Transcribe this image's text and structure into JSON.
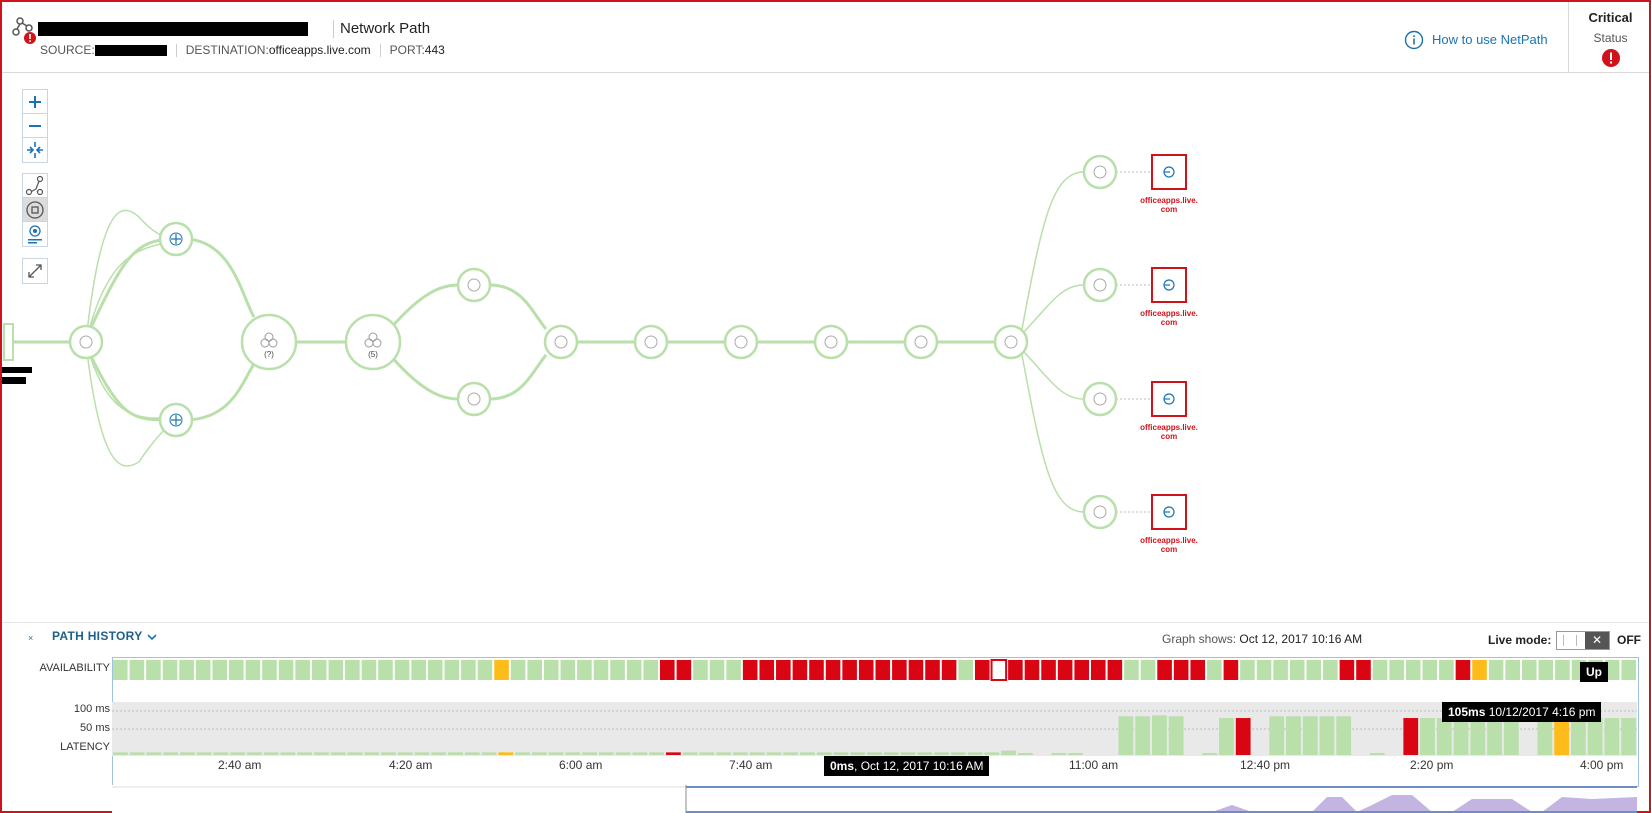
{
  "header": {
    "title": "Network Path",
    "source_label": "SOURCE:",
    "destination_label": "DESTINATION:",
    "destination_value": "officeapps.live.com",
    "port_label": "PORT:",
    "port_value": "443",
    "howto_label": "How to use NetPath",
    "status_value": "Critical",
    "status_label": "Status"
  },
  "graph": {
    "group_counts": [
      "(?)",
      "(5)"
    ],
    "destination_label_line1": "officeapps.live.",
    "destination_label_line2": "com"
  },
  "path_history": {
    "title": "PATH HISTORY",
    "collapse_icon": "×",
    "graph_shows_label": "Graph shows:",
    "graph_shows_value": "Oct 12, 2017 10:16 AM",
    "live_mode_label": "Live mode:",
    "live_mode_state": "OFF",
    "availability_label": "AVAILABILITY",
    "latency_label": "LATENCY",
    "latency_ticks": [
      "100 ms",
      "50 ms"
    ],
    "time_labels": [
      "2:40 am",
      "4:20 am",
      "6:00 am",
      "7:40 am",
      "11:00 am",
      "12:40 pm",
      "2:20 pm",
      "4:00 pm"
    ],
    "tooltip_up": "Up",
    "tooltip_latency_value": "105ms",
    "tooltip_latency_time": "10/12/2017 4:16 pm",
    "tooltip_selected_value": "0ms",
    "tooltip_selected_time": ", Oct 12, 2017 10:16 AM",
    "availability": "GGGGGGGGGGGGGGGGGGGGGGGYGGGGGGGGGRRGGGRRRRRRRRRRRRRGRWRRRRRRRGGRRRGRGGGGGGRRGGGGGRYGGGGGGGGG",
    "latency_values": [
      6,
      6,
      6,
      6,
      6,
      6,
      6,
      6,
      6,
      6,
      6,
      6,
      6,
      6,
      6,
      6,
      6,
      6,
      6,
      6,
      6,
      6,
      6,
      6,
      6,
      6,
      6,
      6,
      6,
      6,
      6,
      6,
      6,
      6,
      6,
      6,
      6,
      6,
      6,
      6,
      6,
      6,
      6,
      6,
      6,
      6,
      6,
      6,
      6,
      6,
      6,
      6,
      6,
      10,
      3,
      0,
      2,
      2,
      0,
      0,
      88,
      88,
      90,
      88,
      0,
      4,
      84,
      84,
      0,
      88,
      88,
      88,
      88,
      88,
      0,
      4,
      0,
      84,
      84,
      84,
      84,
      84,
      84,
      84,
      0,
      84,
      84,
      84,
      84,
      84,
      84
    ],
    "latency_colors": "GGGGGGGGGGGGGGGGGGGGGGGYGGGGGGGGGRGGGGGGGGGGGGGGGGGGGGGRGGGGGGGGGGGRGGGGGGGGGRGGGGGGGGYGGGGGG",
    "colors": {
      "green": "#b9dfaa",
      "red": "#d90512",
      "yellow": "#fdbc1a",
      "white": "#ffffff",
      "node_stroke": "#b9dfaa",
      "link": "#b9dfaa",
      "critical": "#d0121b",
      "accent": "#1a73b5"
    }
  },
  "icons": {
    "zoom_in": "plus-icon",
    "zoom_out": "minus-icon",
    "fit": "fit-icon",
    "path": "path-icon",
    "node": "node-icon",
    "label": "label-icon",
    "expand": "expand-icon",
    "info": "info-icon",
    "status": "alert-icon"
  }
}
